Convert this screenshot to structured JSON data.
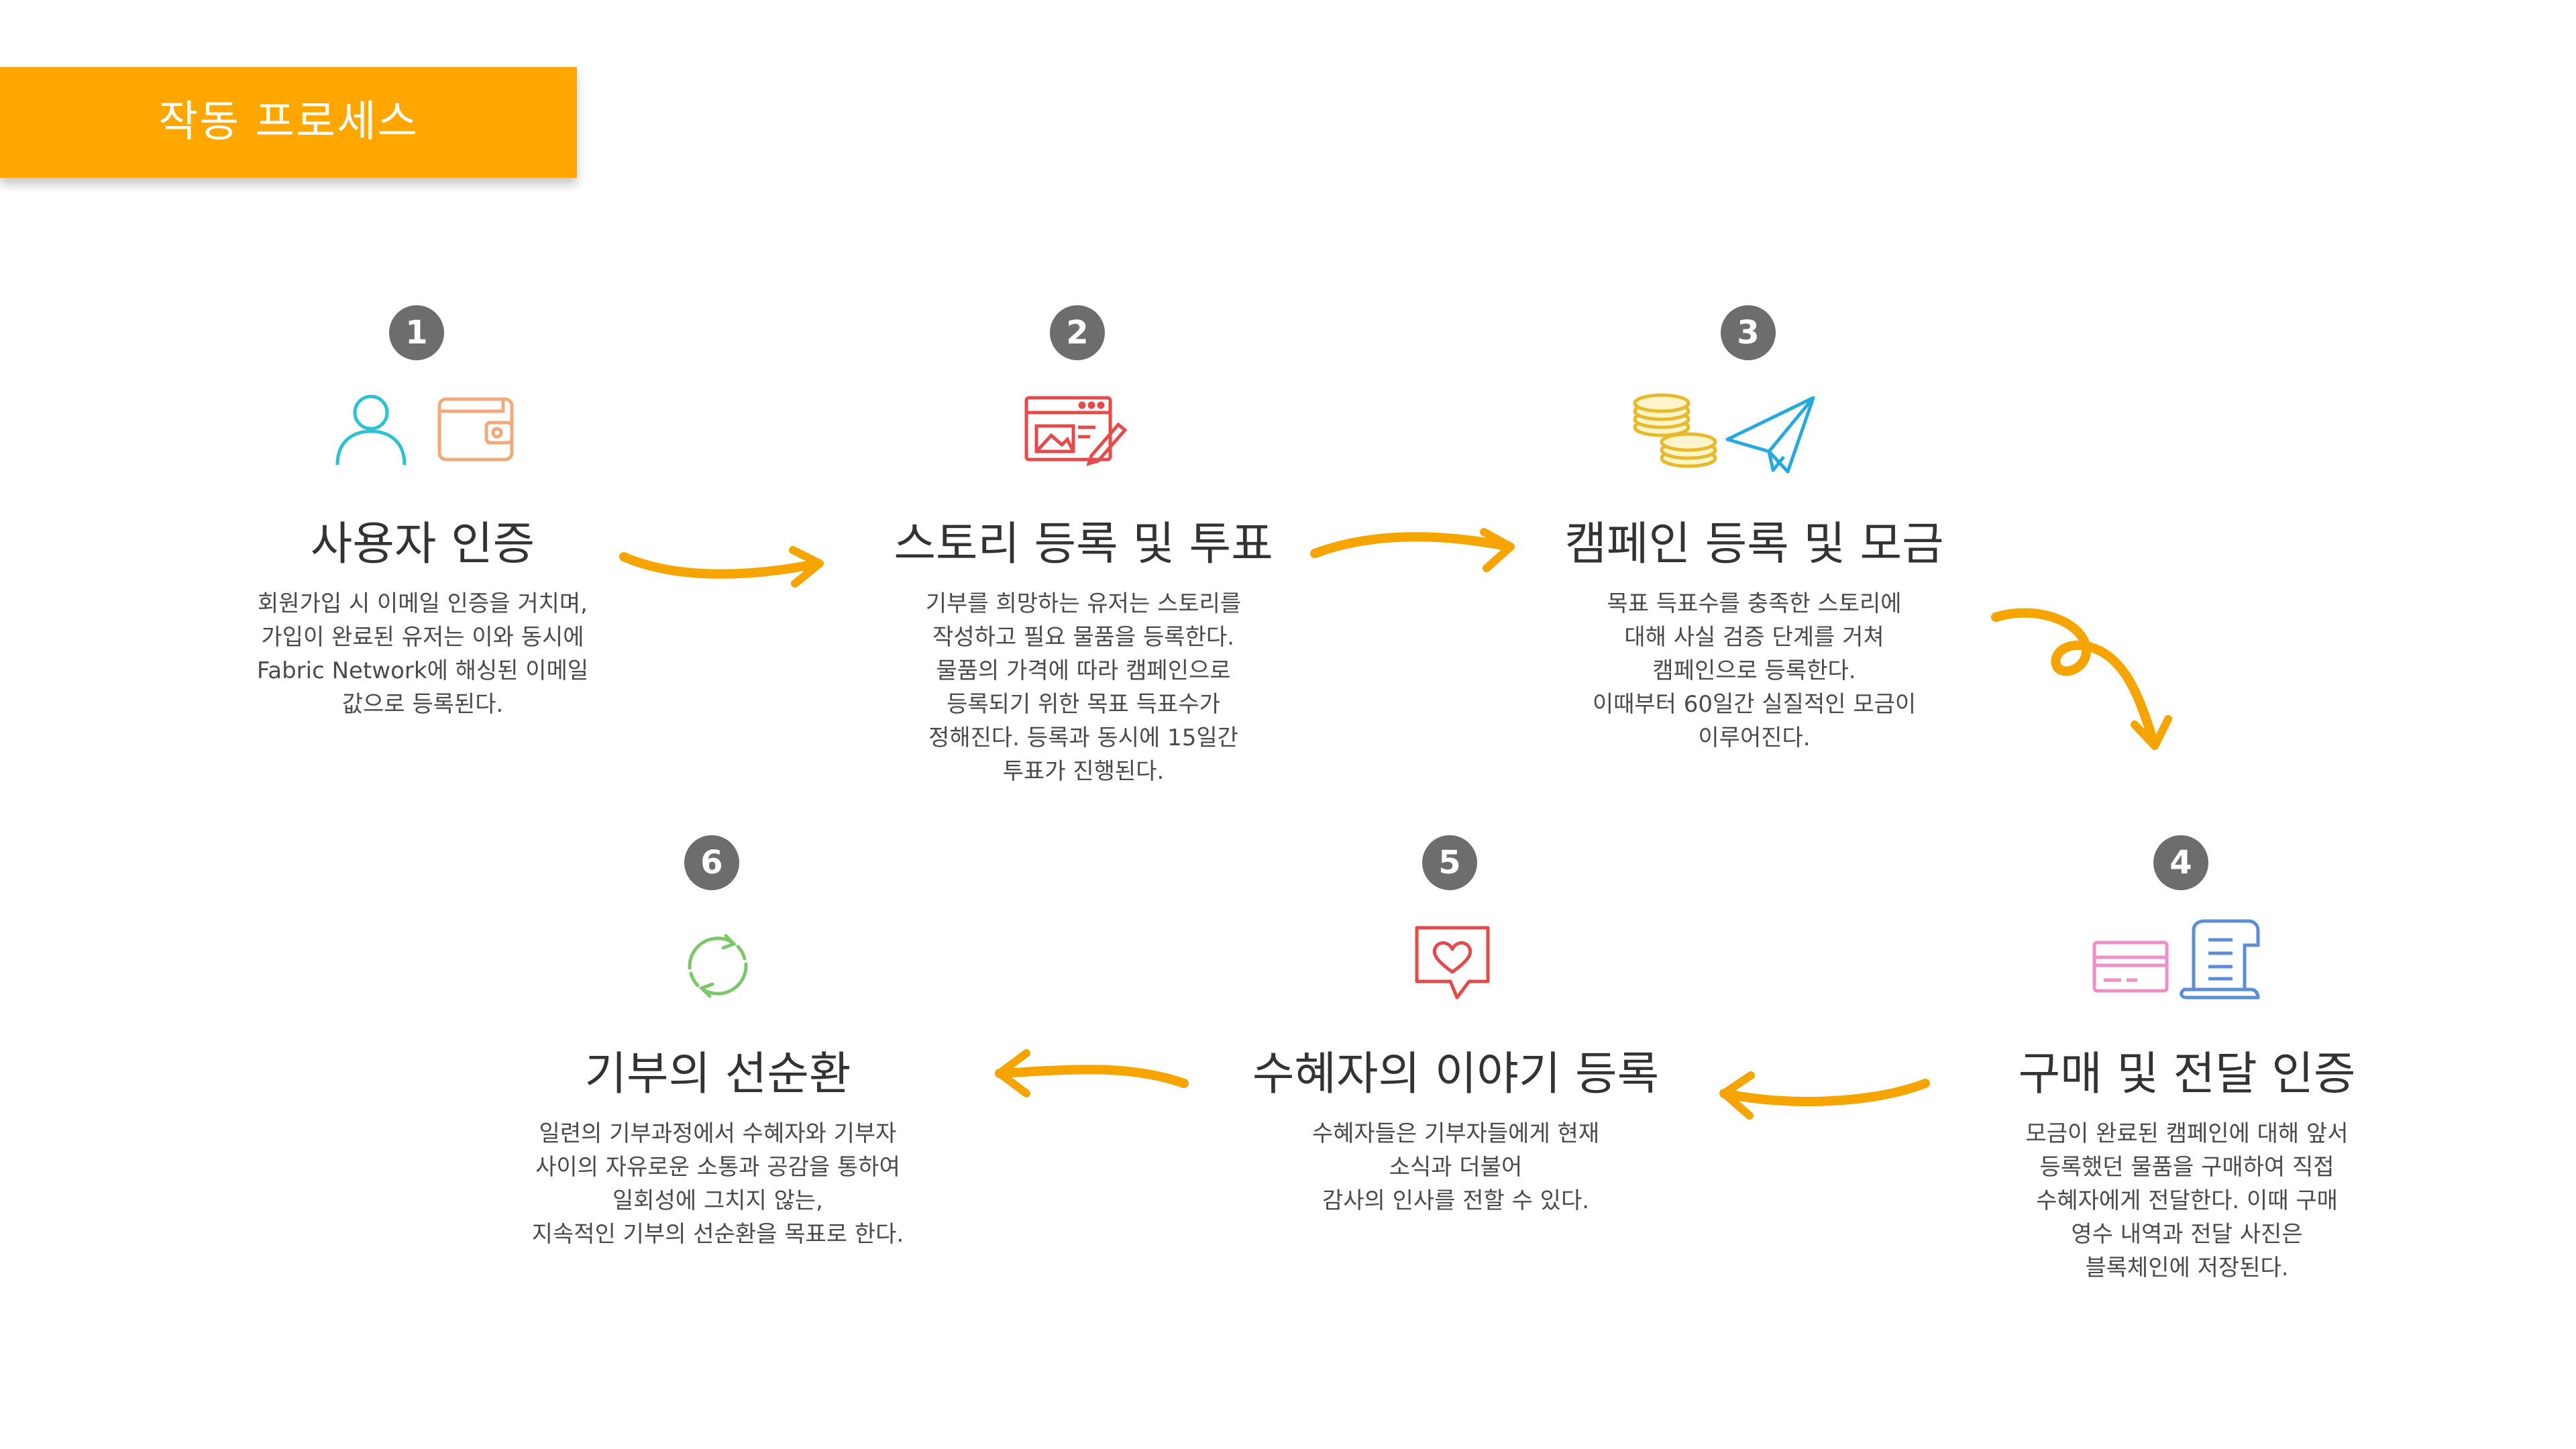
{
  "header": {
    "title": "작동 프로세스"
  },
  "steps": [
    {
      "number": "1",
      "title": "사용자 인증",
      "icons": [
        "user-icon",
        "wallet-icon"
      ],
      "lines": [
        "회원가입 시 이메일 인증을 거치며,",
        "가입이 완료된 유저는 이와 동시에",
        "Fabric Network에 해싱된 이메일",
        "값으로 등록된다."
      ]
    },
    {
      "number": "2",
      "title": "스토리 등록 및 투표",
      "icons": [
        "web-edit-icon"
      ],
      "lines": [
        "기부를 희망하는 유저는 스토리를",
        "작성하고 필요 물품을 등록한다.",
        "물품의 가격에 따라 캠페인으로",
        "등록되기 위한 목표 득표수가",
        "정해진다. 등록과 동시에 15일간",
        "투표가 진행된다."
      ]
    },
    {
      "number": "3",
      "title": "캠페인 등록 및 모금",
      "icons": [
        "coins-icon",
        "paper-plane-icon"
      ],
      "lines": [
        "목표 득표수를 충족한 스토리에",
        "대해 사실 검증 단계를 거쳐",
        "캠페인으로 등록한다.",
        "이때부터 60일간 실질적인 모금이",
        "이루어진다."
      ]
    },
    {
      "number": "4",
      "title": "구매 및 전달 인증",
      "icons": [
        "credit-card-icon",
        "receipt-icon"
      ],
      "lines": [
        "모금이 완료된 캠페인에 대해 앞서",
        "등록했던 물품을 구매하여 직접",
        "수혜자에게 전달한다. 이때 구매",
        "영수 내역과 전달 사진은",
        "블록체인에 저장된다."
      ]
    },
    {
      "number": "5",
      "title": "수혜자의 이야기 등록",
      "icons": [
        "heart-message-icon"
      ],
      "lines": [
        "수혜자들은 기부자들에게 현재",
        "소식과 더불어",
        "감사의 인사를 전할 수 있다."
      ]
    },
    {
      "number": "6",
      "title": "기부의 선순환",
      "icons": [
        "recycle-icon"
      ],
      "lines": [
        "일련의 기부과정에서 수혜자와 기부자",
        "사이의 자유로운 소통과 공감을 통하여",
        "일회성에 그치지 않는,",
        "지속적인 기부의 선순환을 목표로 한다."
      ]
    }
  ],
  "colors": {
    "banner": "#ffa600",
    "arrow": "#f5a400",
    "badge": "#6d6d6d",
    "user_icon": "#2cc2d3",
    "wallet_icon": "#f2a97a",
    "web_icon": "#e64b4b",
    "coins_icon": "#e8b92b",
    "plane_icon": "#25a9df",
    "card_icon": "#ef8fc4",
    "receipt_icon": "#5b8ed6",
    "heart_icon": "#e34a4a",
    "recycle_icon": "#7cc76a"
  }
}
